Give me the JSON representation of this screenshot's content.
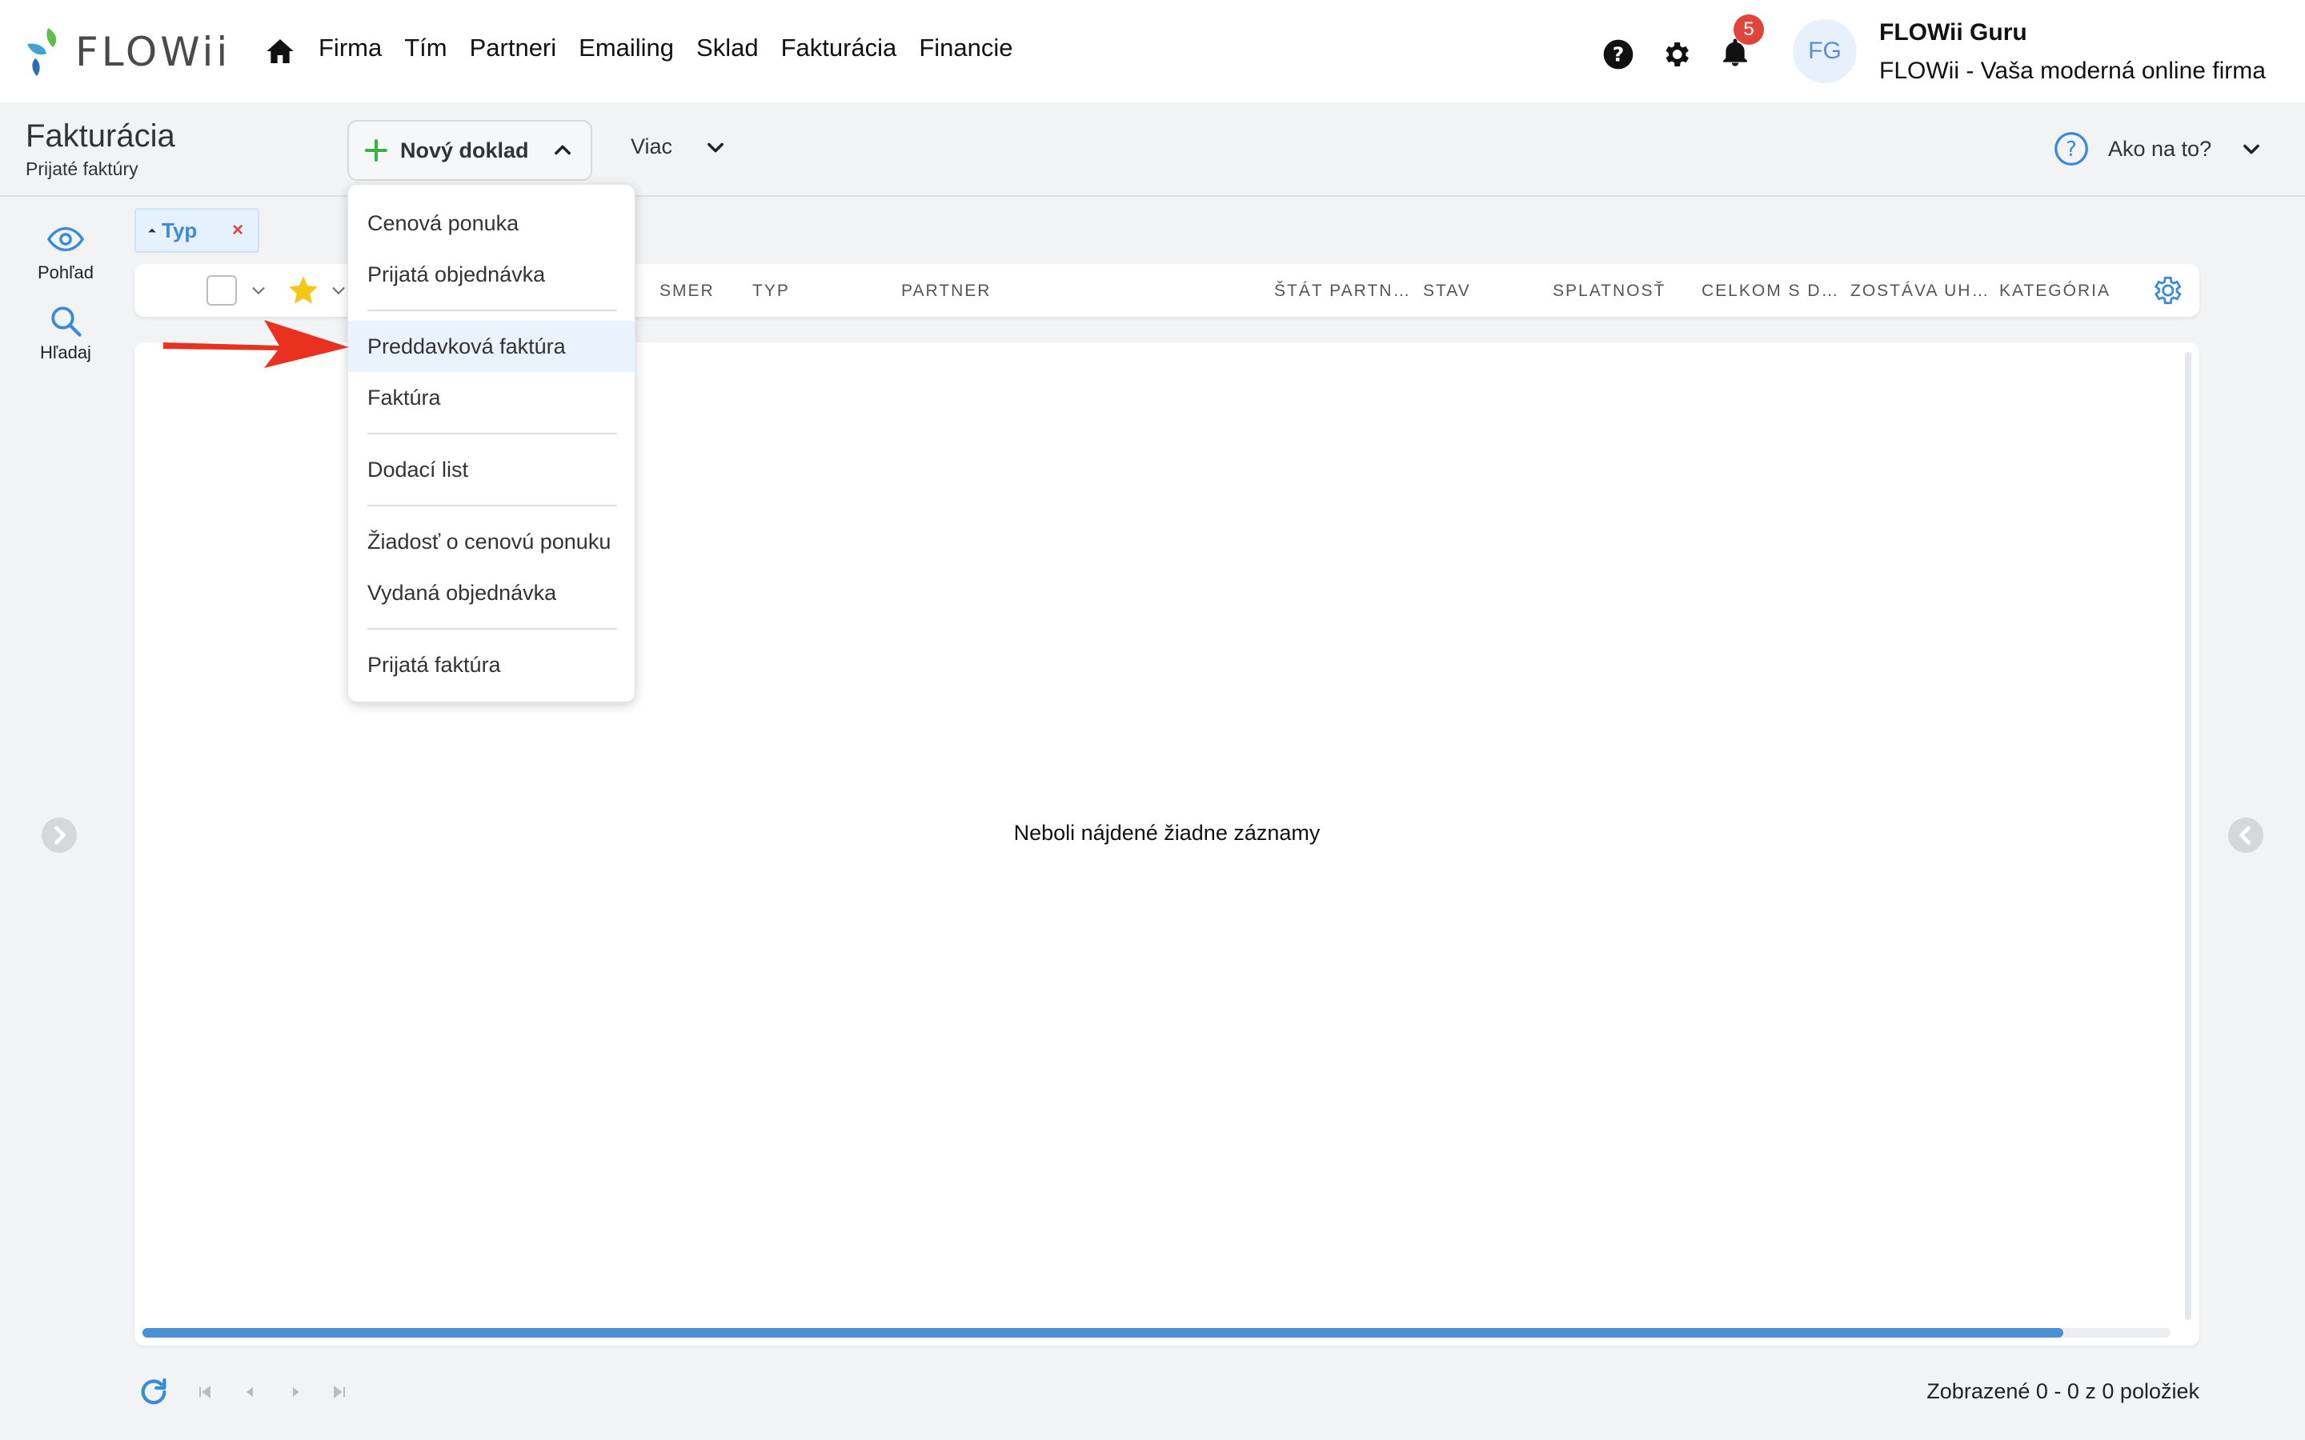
{
  "nav": {
    "brand": "FLOWii",
    "items": [
      "Firma",
      "Tím",
      "Partneri",
      "Emailing",
      "Sklad",
      "Fakturácia",
      "Financie"
    ],
    "notification_count": "5",
    "avatar_initials": "FG",
    "user_name": "FLOWii Guru",
    "user_company": "FLOWii - Vaša moderná online firma"
  },
  "header": {
    "title": "Fakturácia",
    "subtitle": "Prijaté faktúry",
    "new_doc_label": "Nový doklad",
    "more_label": "Viac",
    "help_label": "Ako na to?"
  },
  "rail": {
    "view_label": "Pohľad",
    "search_label": "Hľadaj"
  },
  "filter": {
    "chip_label": "Typ",
    "chip_remove": "×"
  },
  "table": {
    "columns": [
      "SMER",
      "TYP",
      "PARTNER",
      "ŠTÁT PARTN…",
      "STAV",
      "SPLATNOSŤ",
      "CELKOM S D…",
      "ZOSTÁVA UH…",
      "KATEGÓRIA"
    ],
    "empty_message": "Neboli nájdené žiadne záznamy"
  },
  "dropdown": {
    "items": [
      "Cenová ponuka",
      "Prijatá objednávka",
      "Preddavková faktúra",
      "Faktúra",
      "Dodací list",
      "Žiadosť o cenovú ponuku",
      "Vydaná objednávka",
      "Prijatá faktúra"
    ],
    "highlighted": "Preddavková faktúra"
  },
  "footer": {
    "info": "Zobrazené 0 - 0 z 0 položiek"
  },
  "colors": {
    "accent": "#3b8ad8",
    "badge": "#e0443a",
    "plus": "#3cb043",
    "arrow": "#e8311f",
    "star": "#f5c518"
  }
}
